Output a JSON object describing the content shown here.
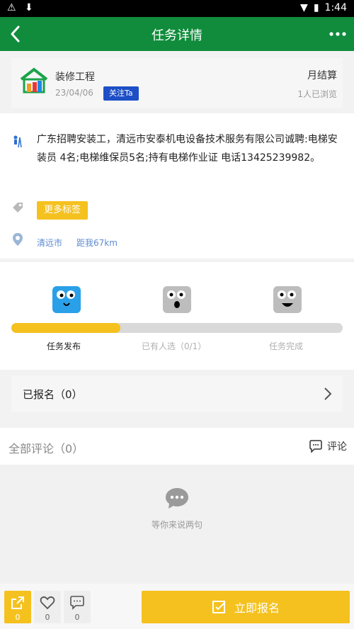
{
  "status_bar": {
    "time": "1:44"
  },
  "app_bar": {
    "title": "任务详情"
  },
  "project": {
    "name": "装修工程",
    "date": "23/04/06",
    "follow_label": "关注Ta",
    "settlement": "月结算",
    "views": "1人已浏览"
  },
  "details": {
    "description": "广东招聘安装工，清远市安泰机电设备技术服务有限公司诚聘:电梯安装员 4名;电梯维保员5名;持有电梯作业证 电话13425239982。",
    "tag_label": "更多标签",
    "location_city": "清远市",
    "distance": "距我67km"
  },
  "progress": {
    "value_percent": 33,
    "steps": [
      {
        "label": "任务发布",
        "active": true
      },
      {
        "label": "已有人选（0/1）",
        "active": false
      },
      {
        "label": "任务完成",
        "active": false
      }
    ]
  },
  "signup": {
    "label": "已报名（0）"
  },
  "comments": {
    "title": "全部评论（0）",
    "action_label": "评论",
    "empty_text": "等你来说两句"
  },
  "bottom_bar": {
    "share_count": "0",
    "like_count": "0",
    "comment_count": "0",
    "cta_label": "立即报名"
  },
  "colors": {
    "app_bar": "#108c3c",
    "accent_yellow": "#f5c11f",
    "follow_blue": "#1d4fc6",
    "location_blue": "#5e8bd0"
  }
}
